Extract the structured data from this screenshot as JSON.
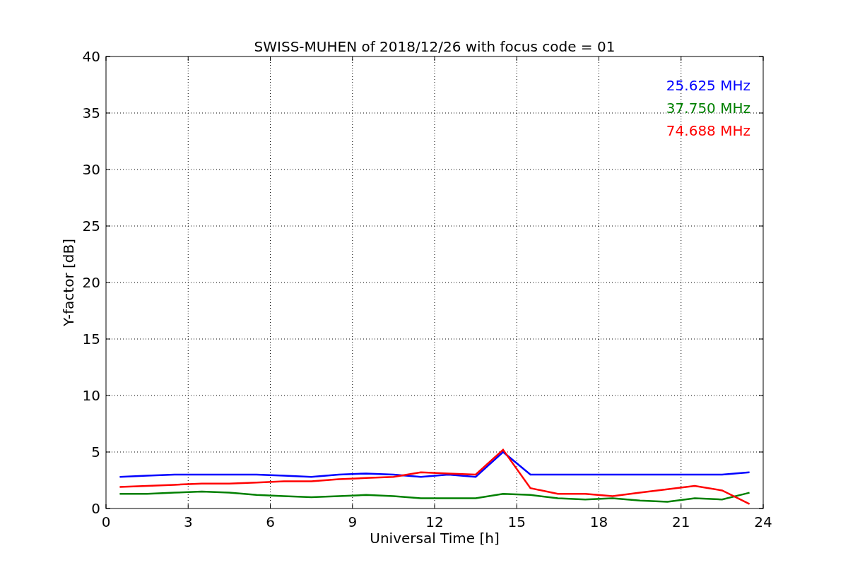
{
  "chart_data": {
    "type": "line",
    "title": "SWISS-MUHEN of 2018/12/26 with focus code = 01",
    "xlabel": "Universal Time [h]",
    "ylabel": "Y-factor [dB]",
    "x": [
      0.5,
      1.5,
      2.5,
      3.5,
      4.5,
      5.5,
      6.5,
      7.5,
      8.5,
      9.5,
      10.5,
      11.5,
      12.5,
      13.5,
      14.5,
      15.5,
      16.5,
      17.5,
      18.5,
      19.5,
      20.5,
      21.5,
      22.5,
      23.5
    ],
    "series": [
      {
        "name": "25.625 MHz",
        "color": "#0000ff",
        "values": [
          2.8,
          2.9,
          3,
          3,
          3,
          3,
          2.9,
          2.8,
          3,
          3.1,
          3,
          2.8,
          3,
          2.8,
          5,
          3,
          3,
          3,
          3,
          3,
          3,
          3,
          3,
          3.2
        ]
      },
      {
        "name": "37.750 MHz",
        "color": "#008000",
        "values": [
          1.3,
          1.3,
          1.4,
          1.5,
          1.4,
          1.2,
          1.1,
          1,
          1.1,
          1.2,
          1.1,
          0.9,
          0.9,
          0.9,
          1.3,
          1.2,
          0.9,
          0.8,
          0.9,
          0.7,
          0.6,
          0.9,
          0.8,
          1.4
        ]
      },
      {
        "name": "74.688 MHz",
        "color": "#ff0000",
        "values": [
          1.9,
          2,
          2.1,
          2.2,
          2.2,
          2.3,
          2.4,
          2.4,
          2.6,
          2.7,
          2.8,
          3.2,
          3.1,
          3,
          5.2,
          1.8,
          1.3,
          1.3,
          1.1,
          1.4,
          1.7,
          2,
          1.6,
          0.4
        ]
      }
    ],
    "grid": true,
    "xlim": [
      0,
      24
    ],
    "ylim": [
      0,
      40
    ],
    "xticks": [
      0,
      3,
      6,
      9,
      12,
      15,
      18,
      21,
      24
    ],
    "yticks": [
      0,
      5,
      10,
      15,
      20,
      25,
      30,
      35,
      40
    ]
  }
}
